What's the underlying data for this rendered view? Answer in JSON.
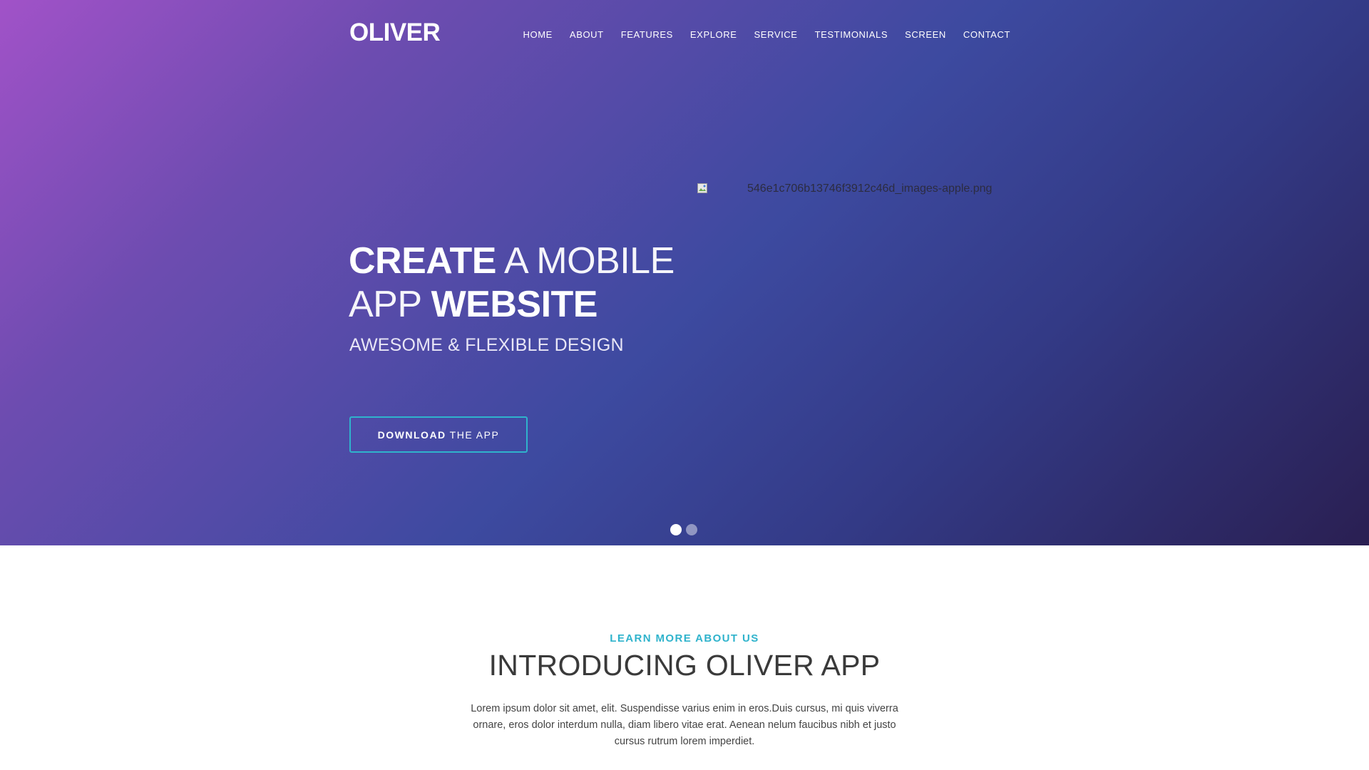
{
  "brand": {
    "logo": "OLIVER"
  },
  "nav": {
    "items": [
      {
        "label": "HOME"
      },
      {
        "label": "ABOUT"
      },
      {
        "label": "FEATURES"
      },
      {
        "label": "EXPLORE"
      },
      {
        "label": "SERVICE"
      },
      {
        "label": "TESTIMONIALS"
      },
      {
        "label": "SCREEN"
      },
      {
        "label": "CONTACT"
      }
    ]
  },
  "hero": {
    "headline": {
      "line1_bold": "CREATE",
      "line1_thin": " A MOBILE",
      "line2_thin": "APP ",
      "line2_bold": "WEBSITE"
    },
    "subheadline": "AWESOME & FLEXIBLE DESIGN",
    "cta": {
      "bold": "DOWNLOAD",
      "rest": "THE APP"
    },
    "image_alt": "546e1c706b13746f3912c46d_images-apple.png",
    "slider": {
      "count": 2,
      "active_index": 0
    }
  },
  "about": {
    "eyebrow": "LEARN MORE ABOUT US",
    "title": "INTRODUCING  OLIVER APP",
    "body": "Lorem ipsum dolor sit amet,  elit. Suspendisse varius enim in eros.Duis cursus, mi quis viverra ornare, eros dolor interdum nulla, diam libero vitae erat. Aenean nelum faucibus nibh et justo cursus rutrum lorem imperdiet."
  },
  "colors": {
    "accent": "#2fb3cc",
    "hero_gradient_start": "#a152c8",
    "hero_gradient_mid": "#3d4aa0",
    "hero_gradient_end": "#2a1f52"
  }
}
